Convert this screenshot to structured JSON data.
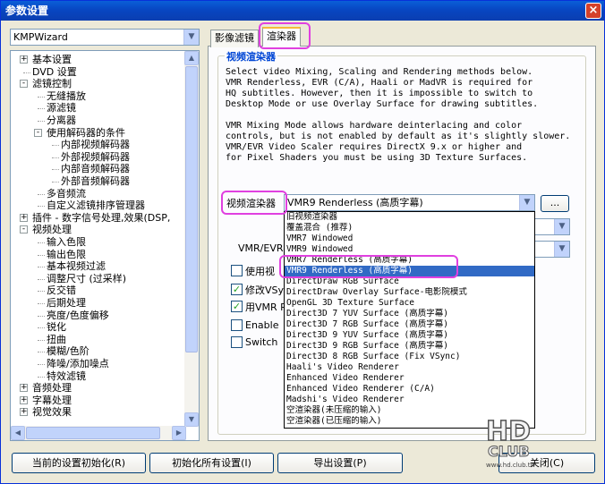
{
  "window": {
    "title": "参数设置",
    "close_label": "×"
  },
  "preset": {
    "value": "KMPWizard"
  },
  "tree": {
    "items": [
      {
        "label": "基本设置",
        "box": "+"
      },
      {
        "label": "DVD 设置",
        "box": ""
      },
      {
        "label": "滤镜控制",
        "box": "-"
      },
      {
        "label": "无缝播放",
        "box": ""
      },
      {
        "label": "源滤镜",
        "box": ""
      },
      {
        "label": "分离器",
        "box": ""
      },
      {
        "label": "使用解码器的条件",
        "box": "-"
      },
      {
        "label": "内部视频解码器",
        "box": ""
      },
      {
        "label": "外部视频解码器",
        "box": ""
      },
      {
        "label": "内部音频解码器",
        "box": ""
      },
      {
        "label": "外部音频解码器",
        "box": ""
      },
      {
        "label": "多音频流",
        "box": ""
      },
      {
        "label": "自定义滤镜排序管理器",
        "box": ""
      },
      {
        "label": "插件 - 数字信号处理,效果(DSP,",
        "box": "+"
      },
      {
        "label": "视频处理",
        "box": "-"
      },
      {
        "label": "输入色限",
        "box": ""
      },
      {
        "label": "输出色限",
        "box": ""
      },
      {
        "label": "基本视频过滤",
        "box": ""
      },
      {
        "label": "调整尺寸 (过采样)",
        "box": ""
      },
      {
        "label": "反交错",
        "box": ""
      },
      {
        "label": "后期处理",
        "box": ""
      },
      {
        "label": "亮度/色度偏移",
        "box": ""
      },
      {
        "label": "锐化",
        "box": ""
      },
      {
        "label": "扭曲",
        "box": ""
      },
      {
        "label": "模糊/色阶",
        "box": ""
      },
      {
        "label": "降噪/添加噪点",
        "box": ""
      },
      {
        "label": "特效滤镜",
        "box": ""
      },
      {
        "label": "音频处理",
        "box": "+"
      },
      {
        "label": "字幕处理",
        "box": "+"
      },
      {
        "label": "视觉效果",
        "box": "+"
      }
    ]
  },
  "tabs": [
    {
      "label": "影像滤镜"
    },
    {
      "label": "渲染器"
    }
  ],
  "group": {
    "title": "视频渲染器"
  },
  "description": {
    "line1": "Select video Mixing, Scaling and Rendering methods below.",
    "line2": "VMR Renderless, EVR (C/A), Haali or MadVR is required for",
    "line3": "HQ subtitles. However, then it is impossible to switch to",
    "line4": "Desktop Mode or use Overlay Surface for drawing subtitles.",
    "line5": "VMR Mixing Mode allows hardware deinterlacing and color",
    "line6": "controls, but is not enabled by default as it's slightly slower.",
    "line7": "VMR/EVR Video Scaler requires DirectX 9.x or higher and",
    "line8": "for Pixel Shaders you must be using 3D Texture Surfaces."
  },
  "renderer": {
    "label": "视频渲染器",
    "value": "VMR9 Renderless (高质字幕)",
    "more_label": "...",
    "options": [
      "旧视频渲染器",
      "覆盖混合 (推荐)",
      "VMR7 Windowed",
      "VMR9 Windowed",
      "VMR7 Renderless (高质字幕)",
      "VMR9 Renderless (高质字幕)",
      "DirectDraw RGB Surface",
      "DirectDraw Overlay Surface-电影院模式",
      "OpenGL 3D Texture Surface",
      "Direct3D 7 YUV Surface (高质字幕)",
      "Direct3D 7 RGB Surface (高质字幕)",
      "Direct3D 9 YUV Surface (高质字幕)",
      "Direct3D 9 RGB Surface (高质字幕)",
      "Direct3D 8 RGB Surface (Fix VSync)",
      "Haali's Video Renderer",
      "Enhanced Video Renderer",
      "Enhanced Video Renderer (C/A)",
      "Madshi's Video Renderer",
      "空渲染器(未压缩的输入)",
      "空渲染器(已压缩的输入)"
    ],
    "selected_index": 5
  },
  "hidden_labels": {
    "vmr_evr": "VMR/EVR",
    "check1": "使用视",
    "check2": "修改VSy",
    "check3": "用VMR R",
    "check4": "Enable",
    "check5": "Switch"
  },
  "buttons": {
    "reset_current": "当前的设置初始化(R)",
    "reset_all": "初始化所有设置(I)",
    "export": "导出设置(P)",
    "close": "关闭(C)"
  },
  "watermark": {
    "brand": "HDCLUB",
    "url": "www.hd.club.tw"
  },
  "colors": {
    "accent": "#0046d5",
    "highlight": "#e040e0",
    "selection": "#316ac5"
  }
}
